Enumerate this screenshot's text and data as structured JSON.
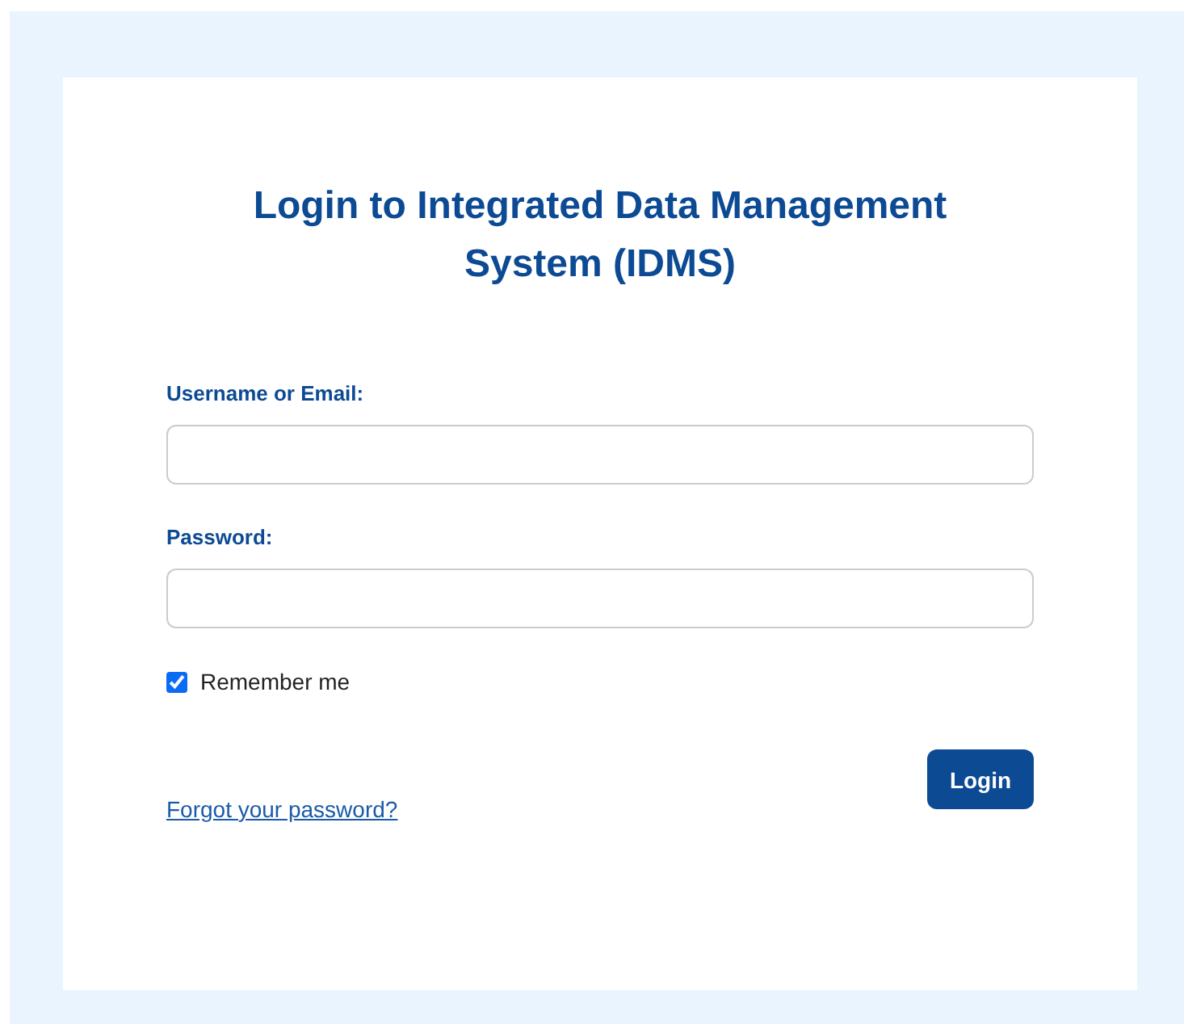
{
  "title": "Login to Integrated Data Management System (IDMS)",
  "fields": [
    {
      "label": "Username or Email:"
    },
    {
      "label": "Password:"
    }
  ],
  "remember": {
    "label": "Remember me",
    "checked": true
  },
  "forgot_link": "Forgot your password?",
  "login_button": "Login"
}
